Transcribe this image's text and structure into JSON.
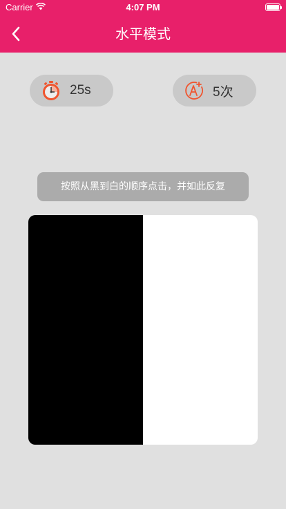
{
  "status_bar": {
    "carrier": "Carrier",
    "time": "4:07 PM"
  },
  "header": {
    "title": "水平模式",
    "color": "#e8206a"
  },
  "stats": {
    "timer_value": "25s",
    "timer_icon": "stopwatch-icon",
    "count_value": "5次",
    "count_icon": "grade-a-plus-icon"
  },
  "instruction": "按照从黑到白的顺序点击，并如此反复",
  "board": {
    "blocks": [
      {
        "color": "#000000"
      },
      {
        "color": "#ffffff"
      }
    ]
  }
}
